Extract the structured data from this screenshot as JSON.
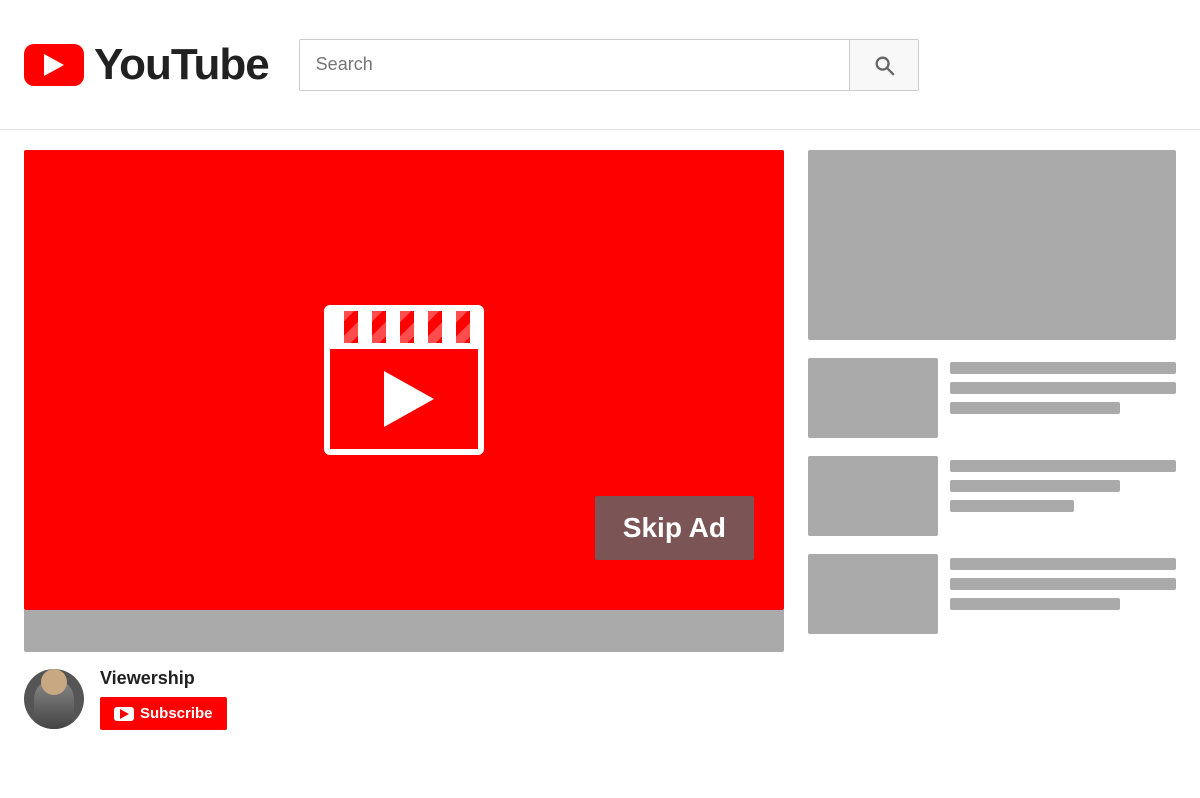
{
  "header": {
    "logo_text": "YouTube",
    "search_placeholder": "Search",
    "search_button_label": "Search"
  },
  "video": {
    "skip_ad_label": "Skip Ad",
    "channel_name": "Viewership",
    "subscribe_label": "Subscribe"
  },
  "sidebar": {
    "items": [
      {
        "id": "rec1"
      },
      {
        "id": "rec2"
      },
      {
        "id": "rec3"
      }
    ]
  }
}
